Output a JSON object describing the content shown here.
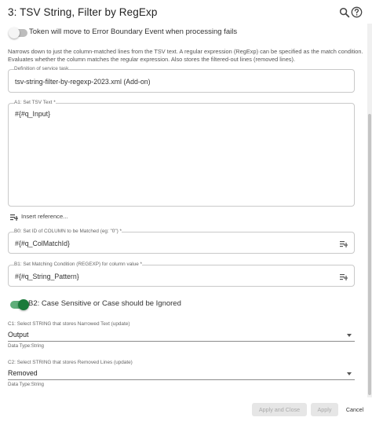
{
  "header": {
    "title": "3: TSV String, Filter by RegExp"
  },
  "error_boundary": {
    "label": "Token will move to Error Boundary Event when processing fails",
    "enabled": false
  },
  "description": "Narrows down to just the column-matched lines from the TSV text. A regular expression (RegExp) can be specified as the match condition. Evaluates whether the column matches the regular expression. Also stores the filtered-out lines (removed lines).",
  "definition": {
    "label": "Definition of service task",
    "value": "tsv-string-filter-by-regexp-2023.xml (Add-on)"
  },
  "a1": {
    "label": "A1: Set TSV Text *",
    "value": "#{#q_Input}"
  },
  "insert_reference": "Insert reference...",
  "b0": {
    "label": "B0: Set ID of COLUMN to be Matched (eg: \"0\") *",
    "value": "#{#q_ColMatchId}"
  },
  "b1": {
    "label": "B1: Set Matching Condition (REGEXP) for column value *",
    "value": "#{#q_String_Pattern}"
  },
  "b2": {
    "label": "B2: Case Sensitive or Case should be Ignored",
    "enabled": true
  },
  "c1": {
    "label": "C1: Select STRING that stores Narrowed Text (update)",
    "value": "Output",
    "help": "Data Type:String"
  },
  "c2": {
    "label": "C2: Select STRING that stores Removed Lines (update)",
    "value": "Removed",
    "help": "Data Type:String"
  },
  "footer": {
    "apply_close": "Apply and Close",
    "apply": "Apply",
    "cancel": "Cancel"
  },
  "colors": {
    "toggle_on": "#1a7a3a",
    "toggle_off": "#bdbdbd",
    "border": "#c9c9c9"
  }
}
